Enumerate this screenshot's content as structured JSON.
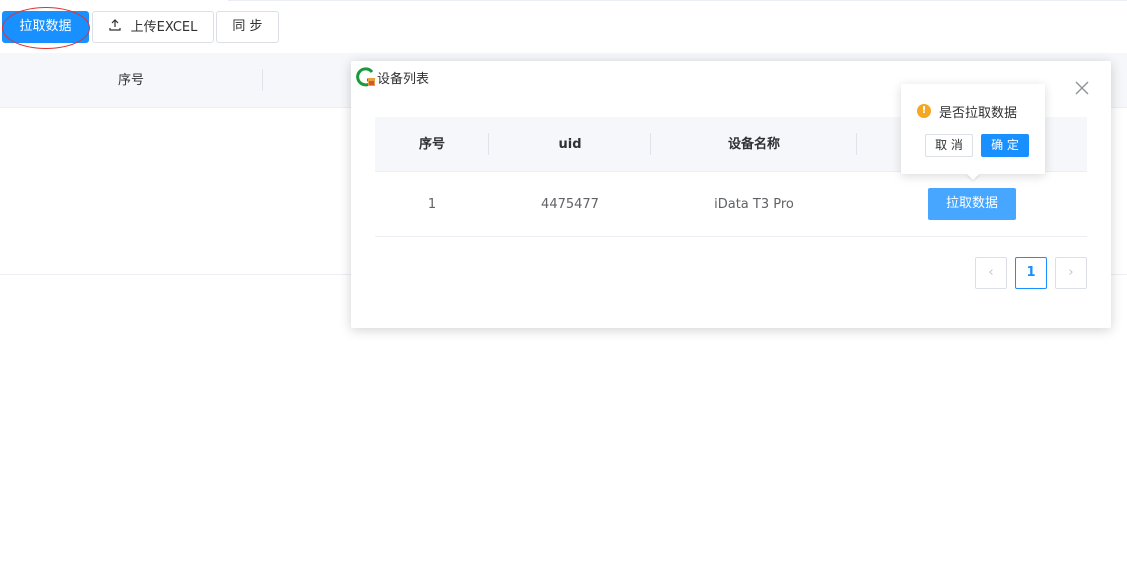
{
  "toolbar": {
    "pull_label": "拉取数据",
    "upload_label": "上传EXCEL",
    "sync_label": "同 步"
  },
  "background_table": {
    "headers": [
      "序号"
    ]
  },
  "dialog": {
    "title": "设备列表",
    "close_icon": "close-icon",
    "table": {
      "headers": [
        "序号",
        "uid",
        "设备名称"
      ],
      "rows": [
        {
          "index": "1",
          "uid": "4475477",
          "name": "iData T3 Pro",
          "action": "拉取数据"
        }
      ]
    },
    "pagination": {
      "current": "1",
      "prev_icon": "‹",
      "next_icon": "›"
    }
  },
  "popconfirm": {
    "message": "是否拉取数据",
    "cancel_label": "取 消",
    "ok_label": "确 定"
  },
  "colors": {
    "primary": "#1890ff",
    "row_button": "#47a6ff",
    "warning": "#f5a623",
    "annotation": "#e03131"
  }
}
